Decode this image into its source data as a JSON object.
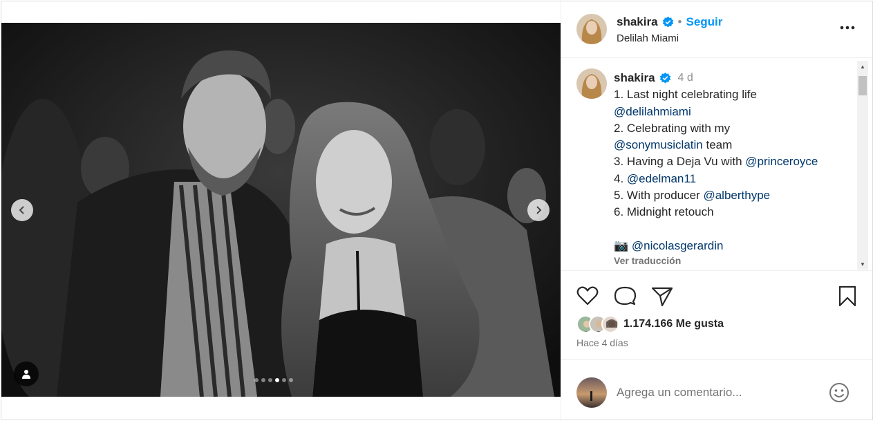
{
  "header": {
    "username": "shakira",
    "separator": "•",
    "follow_label": "Seguir",
    "location": "Delilah Miami",
    "more_icon": "more-options-icon"
  },
  "caption": {
    "username": "shakira",
    "time": "4 d",
    "lines": [
      {
        "text": "1. Last night celebrating life",
        "mention": ""
      },
      {
        "text": "",
        "mention": "@delilahmiami"
      },
      {
        "text": "2. Celebrating with my",
        "mention": ""
      },
      {
        "text": "",
        "mention": "@sonymusiclatin",
        "after": " team"
      },
      {
        "text": "3. Having a Deja Vu with ",
        "mention": "@princeroyce"
      },
      {
        "text": "4. ",
        "mention": "@edelman11"
      },
      {
        "text": "5. With producer ",
        "mention": "@alberthype"
      },
      {
        "text": "6. Midnight retouch",
        "mention": ""
      },
      {
        "text": "",
        "mention": ""
      },
      {
        "text": "📷 ",
        "mention": "@nicolasgerardin"
      }
    ],
    "translate_label": "Ver traducción"
  },
  "media": {
    "carousel_total": 6,
    "carousel_active": 4
  },
  "actions": {
    "like_icon": "heart-icon",
    "comment_icon": "comment-icon",
    "share_icon": "send-icon",
    "save_icon": "bookmark-icon"
  },
  "likes": {
    "count_label": "1.174.166 Me gusta"
  },
  "posted_ago": "Hace 4 días",
  "comment_box": {
    "placeholder": "Agrega un comentario..."
  },
  "colors": {
    "accent": "#0095f6",
    "mention": "#00376b",
    "muted": "#737373"
  }
}
